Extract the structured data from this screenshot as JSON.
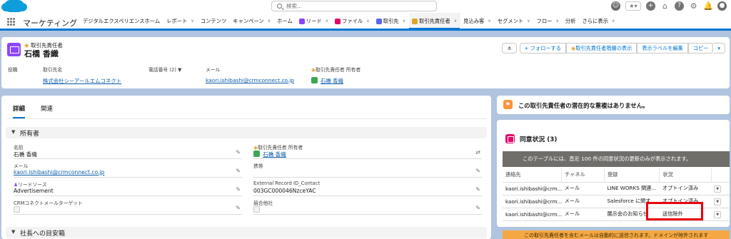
{
  "global_header": {
    "search_placeholder": "検索..."
  },
  "app_nav": {
    "app_name": "マーケティング",
    "items": [
      {
        "label": "デジタルエクスペリエンスホーム",
        "chevron": false
      },
      {
        "label": "レポート",
        "chevron": true
      },
      {
        "label": "コンテンツ",
        "chevron": false
      },
      {
        "label": "キャンペーン",
        "chevron": true
      },
      {
        "label": "ホーム",
        "chevron": false
      },
      {
        "label": "リード",
        "chevron": true
      },
      {
        "label": "ファイル",
        "chevron": true
      },
      {
        "label": "取引先",
        "chevron": true
      },
      {
        "label": "取引先責任者",
        "chevron": true,
        "active": true
      },
      {
        "label": "見込み客",
        "chevron": true
      },
      {
        "label": "セグメント",
        "chevron": true
      },
      {
        "label": "フロー",
        "chevron": true
      },
      {
        "label": "分析",
        "chevron": false
      },
      {
        "label": "さらに表示",
        "chevron": true
      }
    ]
  },
  "record": {
    "type_label": "取引先責任者",
    "title": "石橋 香織",
    "actions": {
      "follow": "+ フォローする",
      "hierarchy": "取引先責任者階層の表示",
      "edit_labels": "表示ラベルを編集",
      "copy": "コピー"
    },
    "highlights": [
      {
        "label": "役職",
        "value": ""
      },
      {
        "label": "取引先名",
        "value": "株式会社シーアールエムコネクト"
      },
      {
        "label": "電話番号 (2) ▼",
        "value": ""
      },
      {
        "label": "メール",
        "value": "kaori.ishibashi@crmconnect.co.jp"
      },
      {
        "label": "取引先責任者 所有者",
        "value": "石橋 香織"
      }
    ]
  },
  "details": {
    "tabs": [
      "詳細",
      "関連"
    ],
    "section_owner": "所有者",
    "section_ceo": "社長への目安箱",
    "fields": {
      "name_label": "名前",
      "name_value": "石橋 香織",
      "owner_label": "取引先責任者 所有者",
      "owner_value": "石橋 香織",
      "email_label": "メール",
      "email_value": "kaori.ishibashi@crmconnect.co.jp",
      "mobile_label": "携帯",
      "mobile_value": "",
      "lead_source_label": "リードソース",
      "lead_source_value": "Advertisement",
      "external_id_label": "External Record ID_Contact",
      "external_id_value": "003GC000046NzceYAC",
      "crm_target_label": "CRMコネクトメールターゲット",
      "competitor_label": "競合他社"
    }
  },
  "duplicates": {
    "text": "この取引先責任者の潜在的な重複はありません。"
  },
  "consent": {
    "title": "同意状況 (3)",
    "banner": "このテーブルには、直近 100 件の同意状況の更新のみが表示されます。",
    "columns": [
      "連絡先",
      "チャネル",
      "登録",
      "状況"
    ],
    "rows": [
      {
        "contact": "kaori.ishibashi@crm...",
        "channel": "メール",
        "registration": "LINE WORKS 関連...",
        "status": "オプトイン済み"
      },
      {
        "contact": "kaori.ishibashi@crm...",
        "channel": "メール",
        "registration": "Salesforce に関す...",
        "status": "オプトイン済み"
      },
      {
        "contact": "kaori.ishibashi@crm...",
        "channel": "メール",
        "registration": "展示会のお知らせ",
        "status": "送信除外"
      }
    ]
  },
  "bottom_notice": "この取引先責任者を含むメールは自動的に送信されます。ドメインが除外されます"
}
